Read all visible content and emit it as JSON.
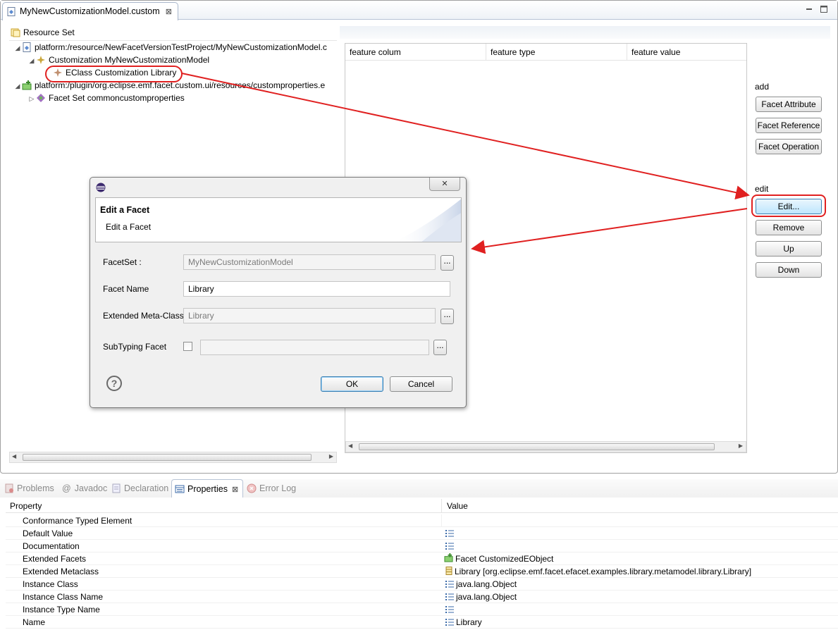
{
  "editor": {
    "tab_title": "MyNewCustomizationModel.custom",
    "tab_close": "⊠"
  },
  "tree": {
    "root": "Resource Set",
    "items": [
      {
        "label": "platform:/resource/NewFacetVersionTestProject/MyNewCustomizationModel.c"
      },
      {
        "label": "Customization MyNewCustomizationModel"
      },
      {
        "label": "EClass Customization Library"
      },
      {
        "label": "platform:/plugin/org.eclipse.emf.facet.custom.ui/resources/customproperties.e"
      },
      {
        "label": "Facet Set commoncustomproperties"
      }
    ]
  },
  "table": {
    "columns": [
      "feature colum",
      "feature type",
      "feature value"
    ]
  },
  "side_buttons": {
    "add_label": "add",
    "facet_attribute": "Facet Attribute",
    "facet_reference": "Facet Reference",
    "facet_operation": "Facet Operation",
    "edit_label": "edit",
    "edit": "Edit...",
    "remove": "Remove",
    "up": "Up",
    "down": "Down"
  },
  "dialog": {
    "title": "Edit a Facet",
    "subtitle": "Edit a Facet",
    "facetset_label": "FacetSet :",
    "facetset_value": "MyNewCustomizationModel",
    "facet_name_label": "Facet Name",
    "facet_name_value": "Library",
    "metaclass_label": "Extended Meta-Class",
    "metaclass_value": "Library",
    "subtyping_label": "SubTyping Facet",
    "subtyping_checked": false,
    "subtyping_value": "",
    "dots": "...",
    "ok": "OK",
    "cancel": "Cancel",
    "help": "?",
    "close": "✕"
  },
  "views": {
    "tabs": [
      {
        "label": "Problems"
      },
      {
        "label": "Javadoc",
        "prefix": "@"
      },
      {
        "label": "Declaration"
      },
      {
        "label": "Properties",
        "active": true
      },
      {
        "label": "Error Log"
      }
    ],
    "tab_close": "⊠"
  },
  "properties": {
    "col_property": "Property",
    "col_value": "Value",
    "rows": [
      {
        "name": "Conformance Typed Element",
        "value": "",
        "icon": ""
      },
      {
        "name": "Default Value",
        "value": "",
        "icon": "list-icon"
      },
      {
        "name": "Documentation",
        "value": "",
        "icon": "list-icon"
      },
      {
        "name": "Extended Facets",
        "value": "Facet CustomizedEObject",
        "icon": "facet-icon"
      },
      {
        "name": "Extended Metaclass",
        "value": "Library [org.eclipse.emf.facet.efacet.examples.library.metamodel.library.Library]",
        "icon": "eclass-icon"
      },
      {
        "name": "Instance Class",
        "value": "java.lang.Object",
        "icon": "list-icon"
      },
      {
        "name": "Instance Class Name",
        "value": "java.lang.Object",
        "icon": "list-icon"
      },
      {
        "name": "Instance Type Name",
        "value": "",
        "icon": "list-icon"
      },
      {
        "name": "Name",
        "value": "Library",
        "icon": "list-icon"
      }
    ]
  },
  "colors": {
    "annotation": "#e02020",
    "selection": "#cde8ff"
  }
}
